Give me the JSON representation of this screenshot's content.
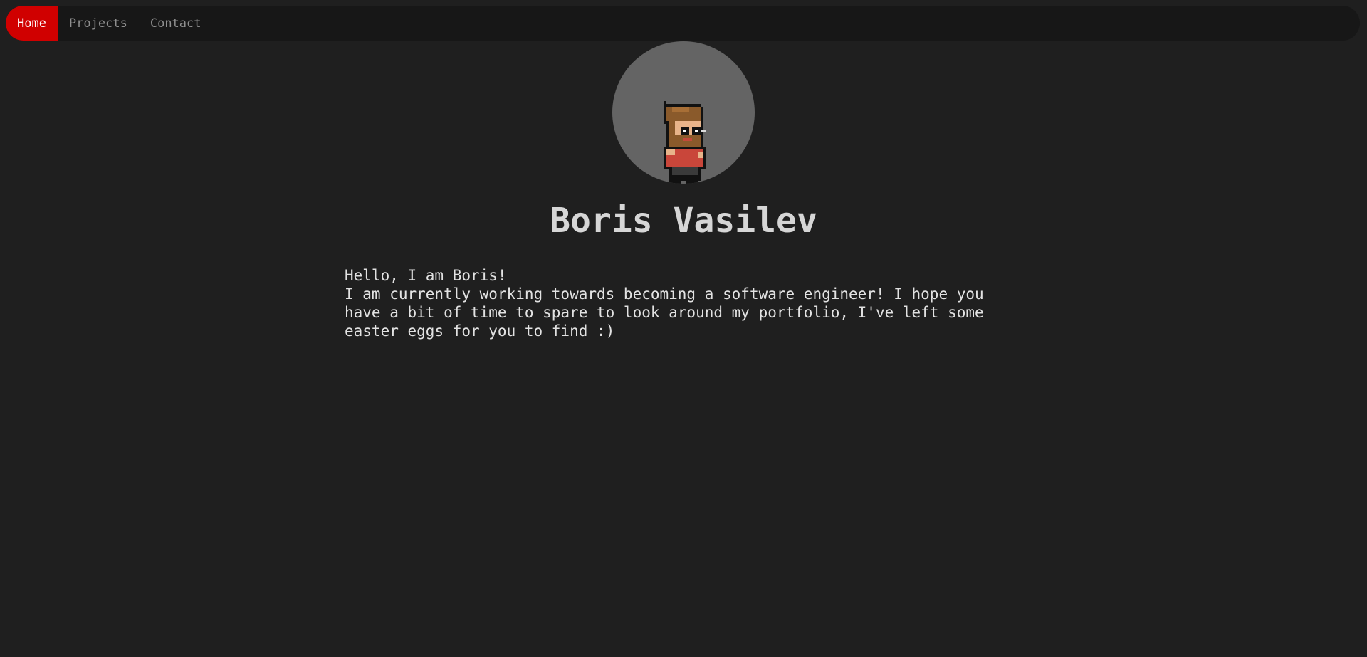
{
  "nav": {
    "items": [
      {
        "label": "Home",
        "active": true
      },
      {
        "label": "Projects",
        "active": false
      },
      {
        "label": "Contact",
        "active": false
      }
    ]
  },
  "profile": {
    "avatar_icon": "pixel-art-character-icon",
    "name": "Boris Vasilev",
    "greeting": "Hello, I am Boris!",
    "bio": "I am currently working towards becoming a software engineer! I hope you have a bit of time to spare to look around my portfolio, I've left some easter eggs for you to find :)"
  },
  "colors": {
    "background": "#1f1f1f",
    "navbar": "#171717",
    "accent": "#d00000",
    "avatar_bg": "#646464"
  }
}
